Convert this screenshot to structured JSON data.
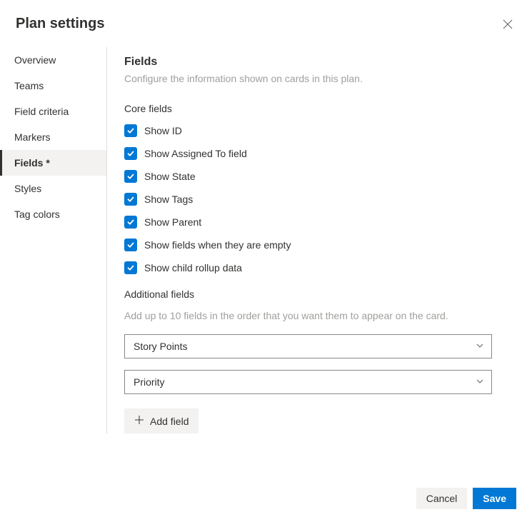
{
  "header": {
    "title": "Plan settings"
  },
  "sidebar": {
    "items": [
      {
        "label": "Overview",
        "selected": false
      },
      {
        "label": "Teams",
        "selected": false
      },
      {
        "label": "Field criteria",
        "selected": false
      },
      {
        "label": "Markers",
        "selected": false
      },
      {
        "label": "Fields *",
        "selected": true
      },
      {
        "label": "Styles",
        "selected": false
      },
      {
        "label": "Tag colors",
        "selected": false
      }
    ]
  },
  "main": {
    "title": "Fields",
    "description": "Configure the information shown on cards in this plan.",
    "coreTitle": "Core fields",
    "coreFields": [
      {
        "label": "Show ID",
        "checked": true
      },
      {
        "label": "Show Assigned To field",
        "checked": true
      },
      {
        "label": "Show State",
        "checked": true
      },
      {
        "label": "Show Tags",
        "checked": true
      },
      {
        "label": "Show Parent",
        "checked": true
      },
      {
        "label": "Show fields when they are empty",
        "checked": true
      },
      {
        "label": "Show child rollup data",
        "checked": true
      }
    ],
    "additionalTitle": "Additional fields",
    "additionalDesc": "Add up to 10 fields in the order that you want them to appear on the card.",
    "additionalFields": [
      {
        "value": "Story Points"
      },
      {
        "value": "Priority"
      }
    ],
    "addFieldLabel": "Add field"
  },
  "footer": {
    "cancel": "Cancel",
    "save": "Save"
  }
}
